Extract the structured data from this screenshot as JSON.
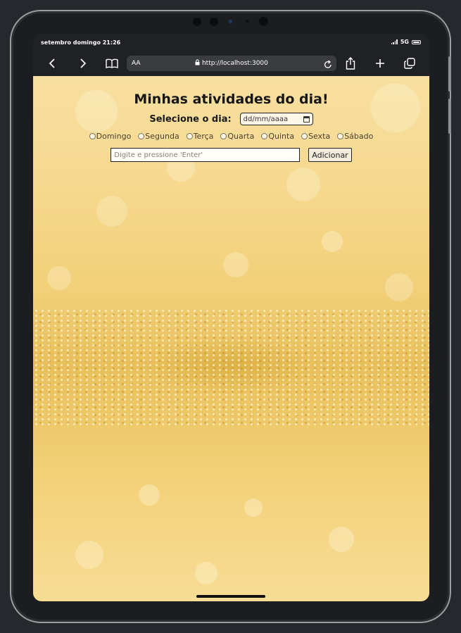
{
  "status_bar": {
    "time": "setembro domingo 21:26",
    "network": "5G"
  },
  "browser": {
    "text_size_label": "AA",
    "url": "http://localhost:3000",
    "icons": [
      "back-icon",
      "forward-icon",
      "bookmarks-icon",
      "lock-icon",
      "reload-icon",
      "share-icon",
      "new-tab-icon",
      "tabs-icon"
    ]
  },
  "page": {
    "title": "Minhas atividades do dia!",
    "date_label": "Selecione o dia:",
    "date_placeholder": "dd/mm/aaaa",
    "weekdays": [
      "Domingo",
      "Segunda",
      "Terça",
      "Quarta",
      "Quinta",
      "Sexta",
      "Sábado"
    ],
    "task_placeholder": "Digite e pressione 'Enter'",
    "add_button": "Adicionar"
  },
  "colors": {
    "background_gold": "#f2d07a",
    "device_frame": "#1b1d20",
    "urlbar": "#3a3c40"
  }
}
